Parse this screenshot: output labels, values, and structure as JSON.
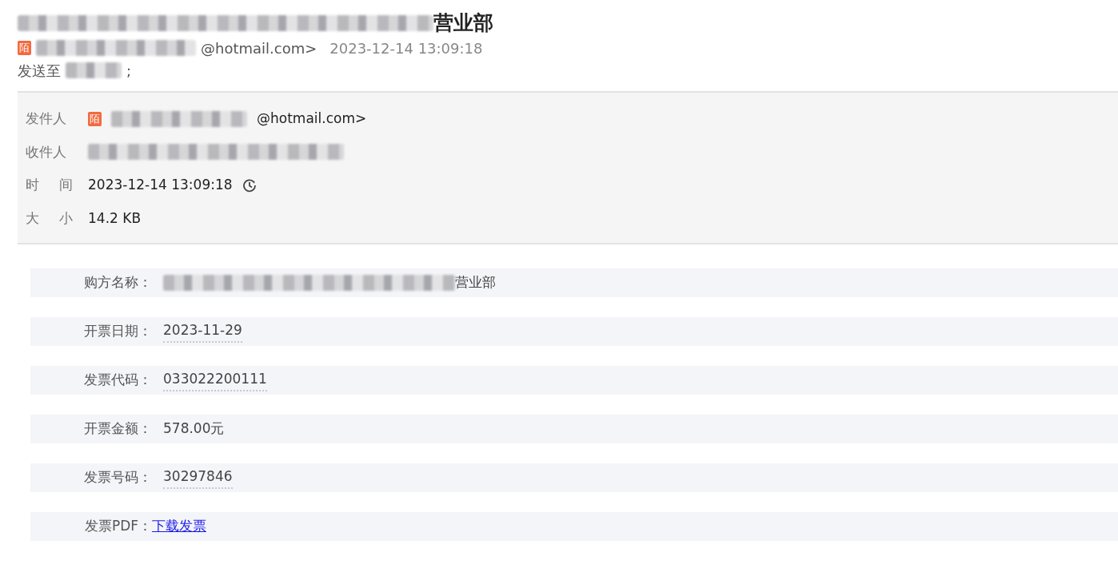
{
  "subject": {
    "visible_text": "营业部"
  },
  "sender": {
    "tag": "陌",
    "address_end": "@hotmail.com>",
    "time": "2023-12-14 13:09:18"
  },
  "recipients": {
    "label": "发送至",
    "separator": ";"
  },
  "details": [
    {
      "label": "发件人",
      "kind": "sender",
      "tag": "陌",
      "value": "@hotmail.com>"
    },
    {
      "label": "收件人",
      "kind": "redacted"
    },
    {
      "label": "时 间",
      "kind": "time",
      "value": "2023-12-14 13:09:18"
    },
    {
      "label": "大 小",
      "kind": "plain",
      "value": "14.2 KB"
    }
  ],
  "invoice_rows": [
    {
      "label": "购方名称：",
      "kind": "redacted-prefix",
      "value": "营业部",
      "underlined": false
    },
    {
      "label": "开票日期：",
      "kind": "text",
      "value": "2023-11-29",
      "underlined": true
    },
    {
      "label": "发票代码：",
      "kind": "text",
      "value": "033022200111",
      "underlined": true
    },
    {
      "label": "开票金额：",
      "kind": "text",
      "value": "578.00元",
      "underlined": false
    },
    {
      "label": "发票号码：",
      "kind": "text",
      "value": "30297846",
      "underlined": true
    },
    {
      "label": "发票PDF：",
      "kind": "link",
      "value": "下载发票",
      "underlined": true
    }
  ]
}
